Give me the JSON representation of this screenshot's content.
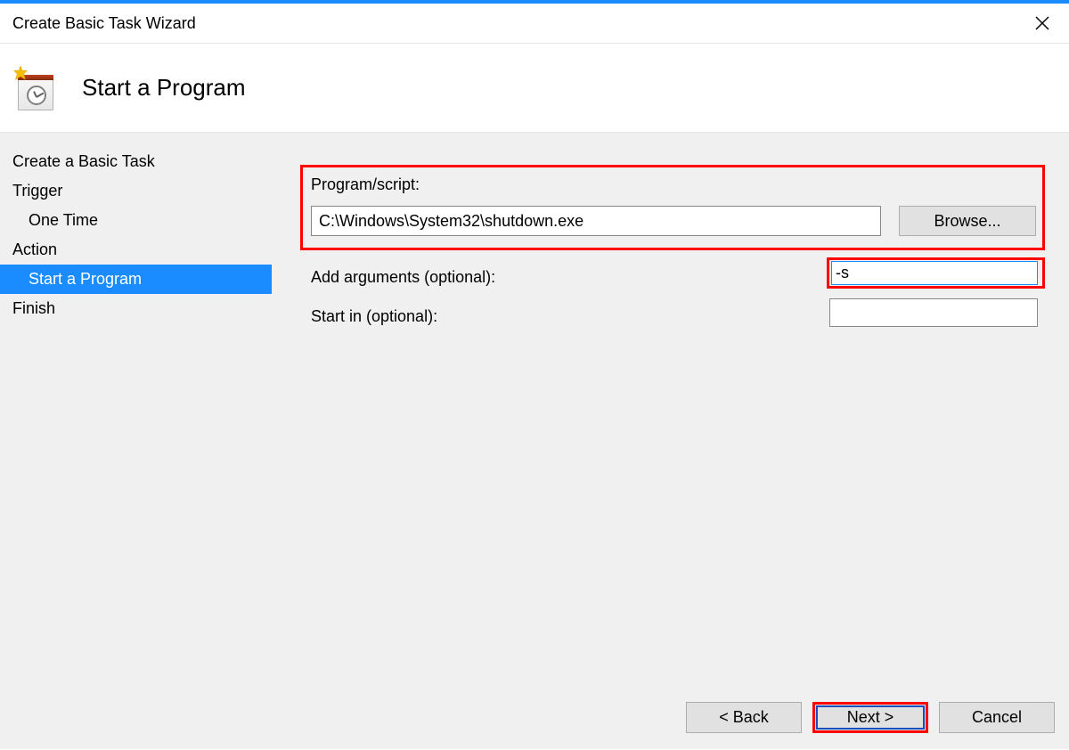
{
  "window": {
    "title": "Create Basic Task Wizard"
  },
  "header": {
    "page_title": "Start a Program"
  },
  "sidebar": {
    "items": [
      {
        "label": "Create a Basic Task",
        "type": "item",
        "selected": false
      },
      {
        "label": "Trigger",
        "type": "item",
        "selected": false
      },
      {
        "label": "One Time",
        "type": "subitem",
        "selected": false
      },
      {
        "label": "Action",
        "type": "item",
        "selected": false
      },
      {
        "label": "Start a Program",
        "type": "subitem",
        "selected": true
      },
      {
        "label": "Finish",
        "type": "item",
        "selected": false
      }
    ]
  },
  "form": {
    "program_label": "Program/script:",
    "program_value": "C:\\Windows\\System32\\shutdown.exe",
    "browse_label": "Browse...",
    "arguments_label": "Add arguments (optional):",
    "arguments_value": "-s",
    "startin_label": "Start in (optional):",
    "startin_value": ""
  },
  "buttons": {
    "back": "< Back",
    "next": "Next >",
    "cancel": "Cancel"
  }
}
